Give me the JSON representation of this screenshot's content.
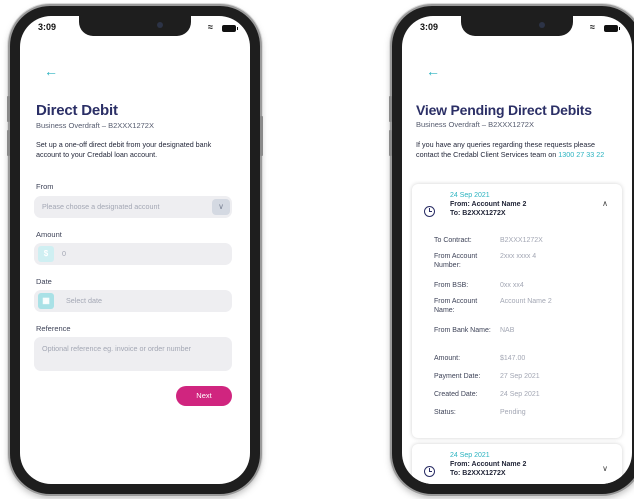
{
  "status": {
    "time": "3:09"
  },
  "direct_debit": {
    "title": "Direct Debit",
    "subtitle": "Business Overdraft – B2XXX1272X",
    "intro": "Set up a one-off direct debit from your designated bank account to your Credabl loan account.",
    "from_label": "From",
    "from_placeholder": "Please choose a designated account",
    "amount_label": "Amount",
    "amount_prefix": "$",
    "amount_value": "0",
    "date_label": "Date",
    "date_placeholder": "Select date",
    "reference_label": "Reference",
    "reference_placeholder": "Optional reference eg. invoice or order number",
    "next_label": "Next"
  },
  "pending": {
    "title": "View Pending Direct Debits",
    "subtitle": "Business Overdraft – B2XXX1272X",
    "intro": "If you have any queries regarding these requests please contact the Credabl Client Services team on",
    "phone": "1300 27 33 22",
    "cards": [
      {
        "date": "24 Sep 2021",
        "from": "From: Account Name 2",
        "to": "To: B2XXX1272X",
        "expanded": true,
        "details": [
          {
            "key": "To Contract:",
            "value": "B2XXX1272X"
          },
          {
            "key": "From Account Number:",
            "value": "2xxx xxxx 4"
          },
          {
            "key": "From BSB:",
            "value": "0xx xx4"
          },
          {
            "key": "From Account Name:",
            "value": "Account Name 2"
          },
          {
            "key": "From Bank Name:",
            "value": "NAB"
          },
          {
            "key": "Amount:",
            "value": "$147.00"
          },
          {
            "key": "Payment Date:",
            "value": "27 Sep 2021"
          },
          {
            "key": "Created Date:",
            "value": "24 Sep 2021"
          },
          {
            "key": "Status:",
            "value": "Pending"
          }
        ]
      },
      {
        "date": "24 Sep 2021",
        "from": "From: Account Name 2",
        "to": "To: B2XXX1272X",
        "expanded": false
      }
    ]
  },
  "colors": {
    "navy": "#2b2f66",
    "teal": "#2bb3c0",
    "magenta": "#d0257f"
  }
}
